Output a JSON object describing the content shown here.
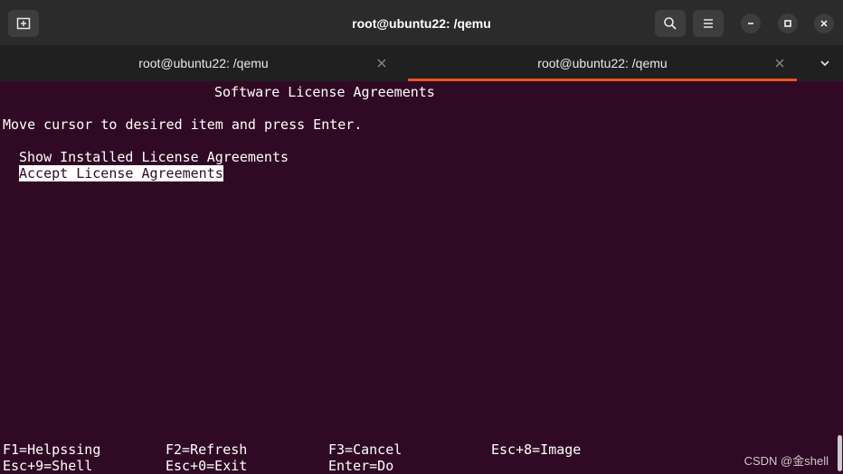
{
  "window": {
    "title": "root@ubuntu22: /qemu"
  },
  "tabs": [
    {
      "label": "root@ubuntu22: /qemu",
      "active": false
    },
    {
      "label": "root@ubuntu22: /qemu",
      "active": true
    }
  ],
  "icons": {
    "new_tab": "new-tab-icon",
    "search": "search-icon",
    "menu": "hamburger-menu-icon",
    "minimize": "minimize-icon",
    "maximize": "maximize-icon",
    "close": "close-icon",
    "tab_close": "close-icon",
    "tab_overflow": "chevron-down-icon"
  },
  "colors": {
    "terminal_bg": "#300a24",
    "accent": "#e95420",
    "text": "#ffffff"
  },
  "terminal": {
    "heading": "Software License Agreements",
    "instruction": "Move cursor to desired item and press Enter.",
    "menu_items": [
      {
        "label": "Show Installed License Agreements",
        "selected": false
      },
      {
        "label": "Accept License Agreements",
        "selected": true
      }
    ],
    "function_keys_row1": [
      "F1=Helpssing",
      "F2=Refresh",
      "F3=Cancel",
      "Esc+8=Image"
    ],
    "function_keys_row2": [
      "Esc+9=Shell",
      "Esc+0=Exit",
      "Enter=Do"
    ]
  },
  "watermark": "CSDN @金shell"
}
